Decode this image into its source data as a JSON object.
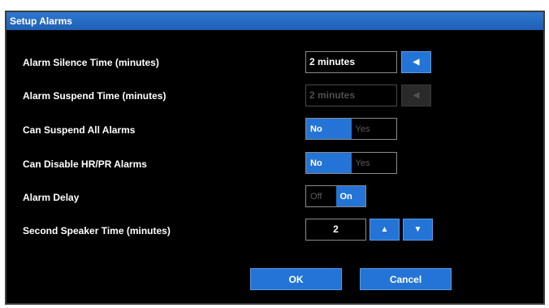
{
  "dialog": {
    "title": "Setup Alarms"
  },
  "rows": {
    "alarm_silence": {
      "label": "Alarm Silence Time (minutes)",
      "value": "2 minutes",
      "button_icon": "triangle-left-icon"
    },
    "alarm_suspend": {
      "label": "Alarm Suspend Time (minutes)",
      "value": "2 minutes",
      "disabled": true,
      "button_icon": "triangle-left-icon"
    },
    "can_suspend_all": {
      "label": "Can Suspend All Alarms",
      "options": [
        "No",
        "Yes"
      ],
      "selected": "No"
    },
    "can_disable_hrpr": {
      "label": "Can Disable HR/PR Alarms",
      "options": [
        "No",
        "Yes"
      ],
      "selected": "No"
    },
    "alarm_delay": {
      "label": "Alarm Delay",
      "options": [
        "Off",
        "On"
      ],
      "selected": "On"
    },
    "second_speaker": {
      "label": "Second Speaker Time (minutes)",
      "value": "2",
      "up_icon": "triangle-up-icon",
      "down_icon": "triangle-down-icon"
    }
  },
  "buttons": {
    "ok": "OK",
    "cancel": "Cancel"
  },
  "colors": {
    "accent": "#2374d6",
    "background": "#000000",
    "title_bar": "#1f5fb3",
    "disabled_text": "#4f4f4f"
  }
}
